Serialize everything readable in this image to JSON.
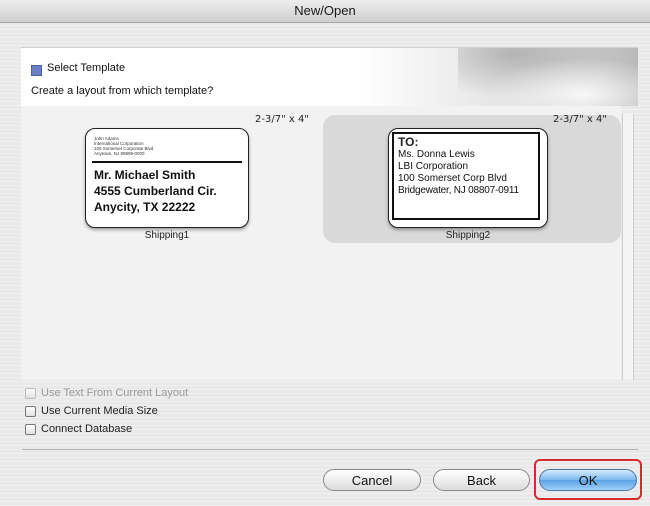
{
  "window": {
    "title": "New/Open"
  },
  "header": {
    "title": "Select Template",
    "subtitle": "Create a layout from which template?"
  },
  "templates": [
    {
      "size": "2-3/7\" x 4\"",
      "name": "Shipping1",
      "sender_lines": [
        "John Adams",
        "International Corporation",
        "100 Somerset Corporate Blvd",
        "Anytown, NJ 99999-0000"
      ],
      "recipient_lines": [
        "Mr. Michael Smith",
        "4555 Cumberland Cir.",
        "Anycity, TX  22222"
      ],
      "selected": false
    },
    {
      "size": "2-3/7\" x 4\"",
      "name": "Shipping2",
      "heading": "TO:",
      "recipient_lines": [
        "Ms. Donna Lewis",
        "LBI Corporation",
        "100 Somerset Corp Blvd",
        "Bridgewater, NJ 08807-0911"
      ],
      "selected": true
    }
  ],
  "options": [
    {
      "label": "Use Text From Current Layout",
      "checked": false,
      "enabled": false
    },
    {
      "label": "Use Current Media Size",
      "checked": false,
      "enabled": true
    },
    {
      "label": "Connect Database",
      "checked": false,
      "enabled": true
    }
  ],
  "buttons": {
    "cancel": "Cancel",
    "back": "Back",
    "ok": "OK"
  },
  "colors": {
    "highlight": "#d42b2b",
    "primary_button": "#5aa2e6",
    "header_square": "#6b7fc4"
  }
}
